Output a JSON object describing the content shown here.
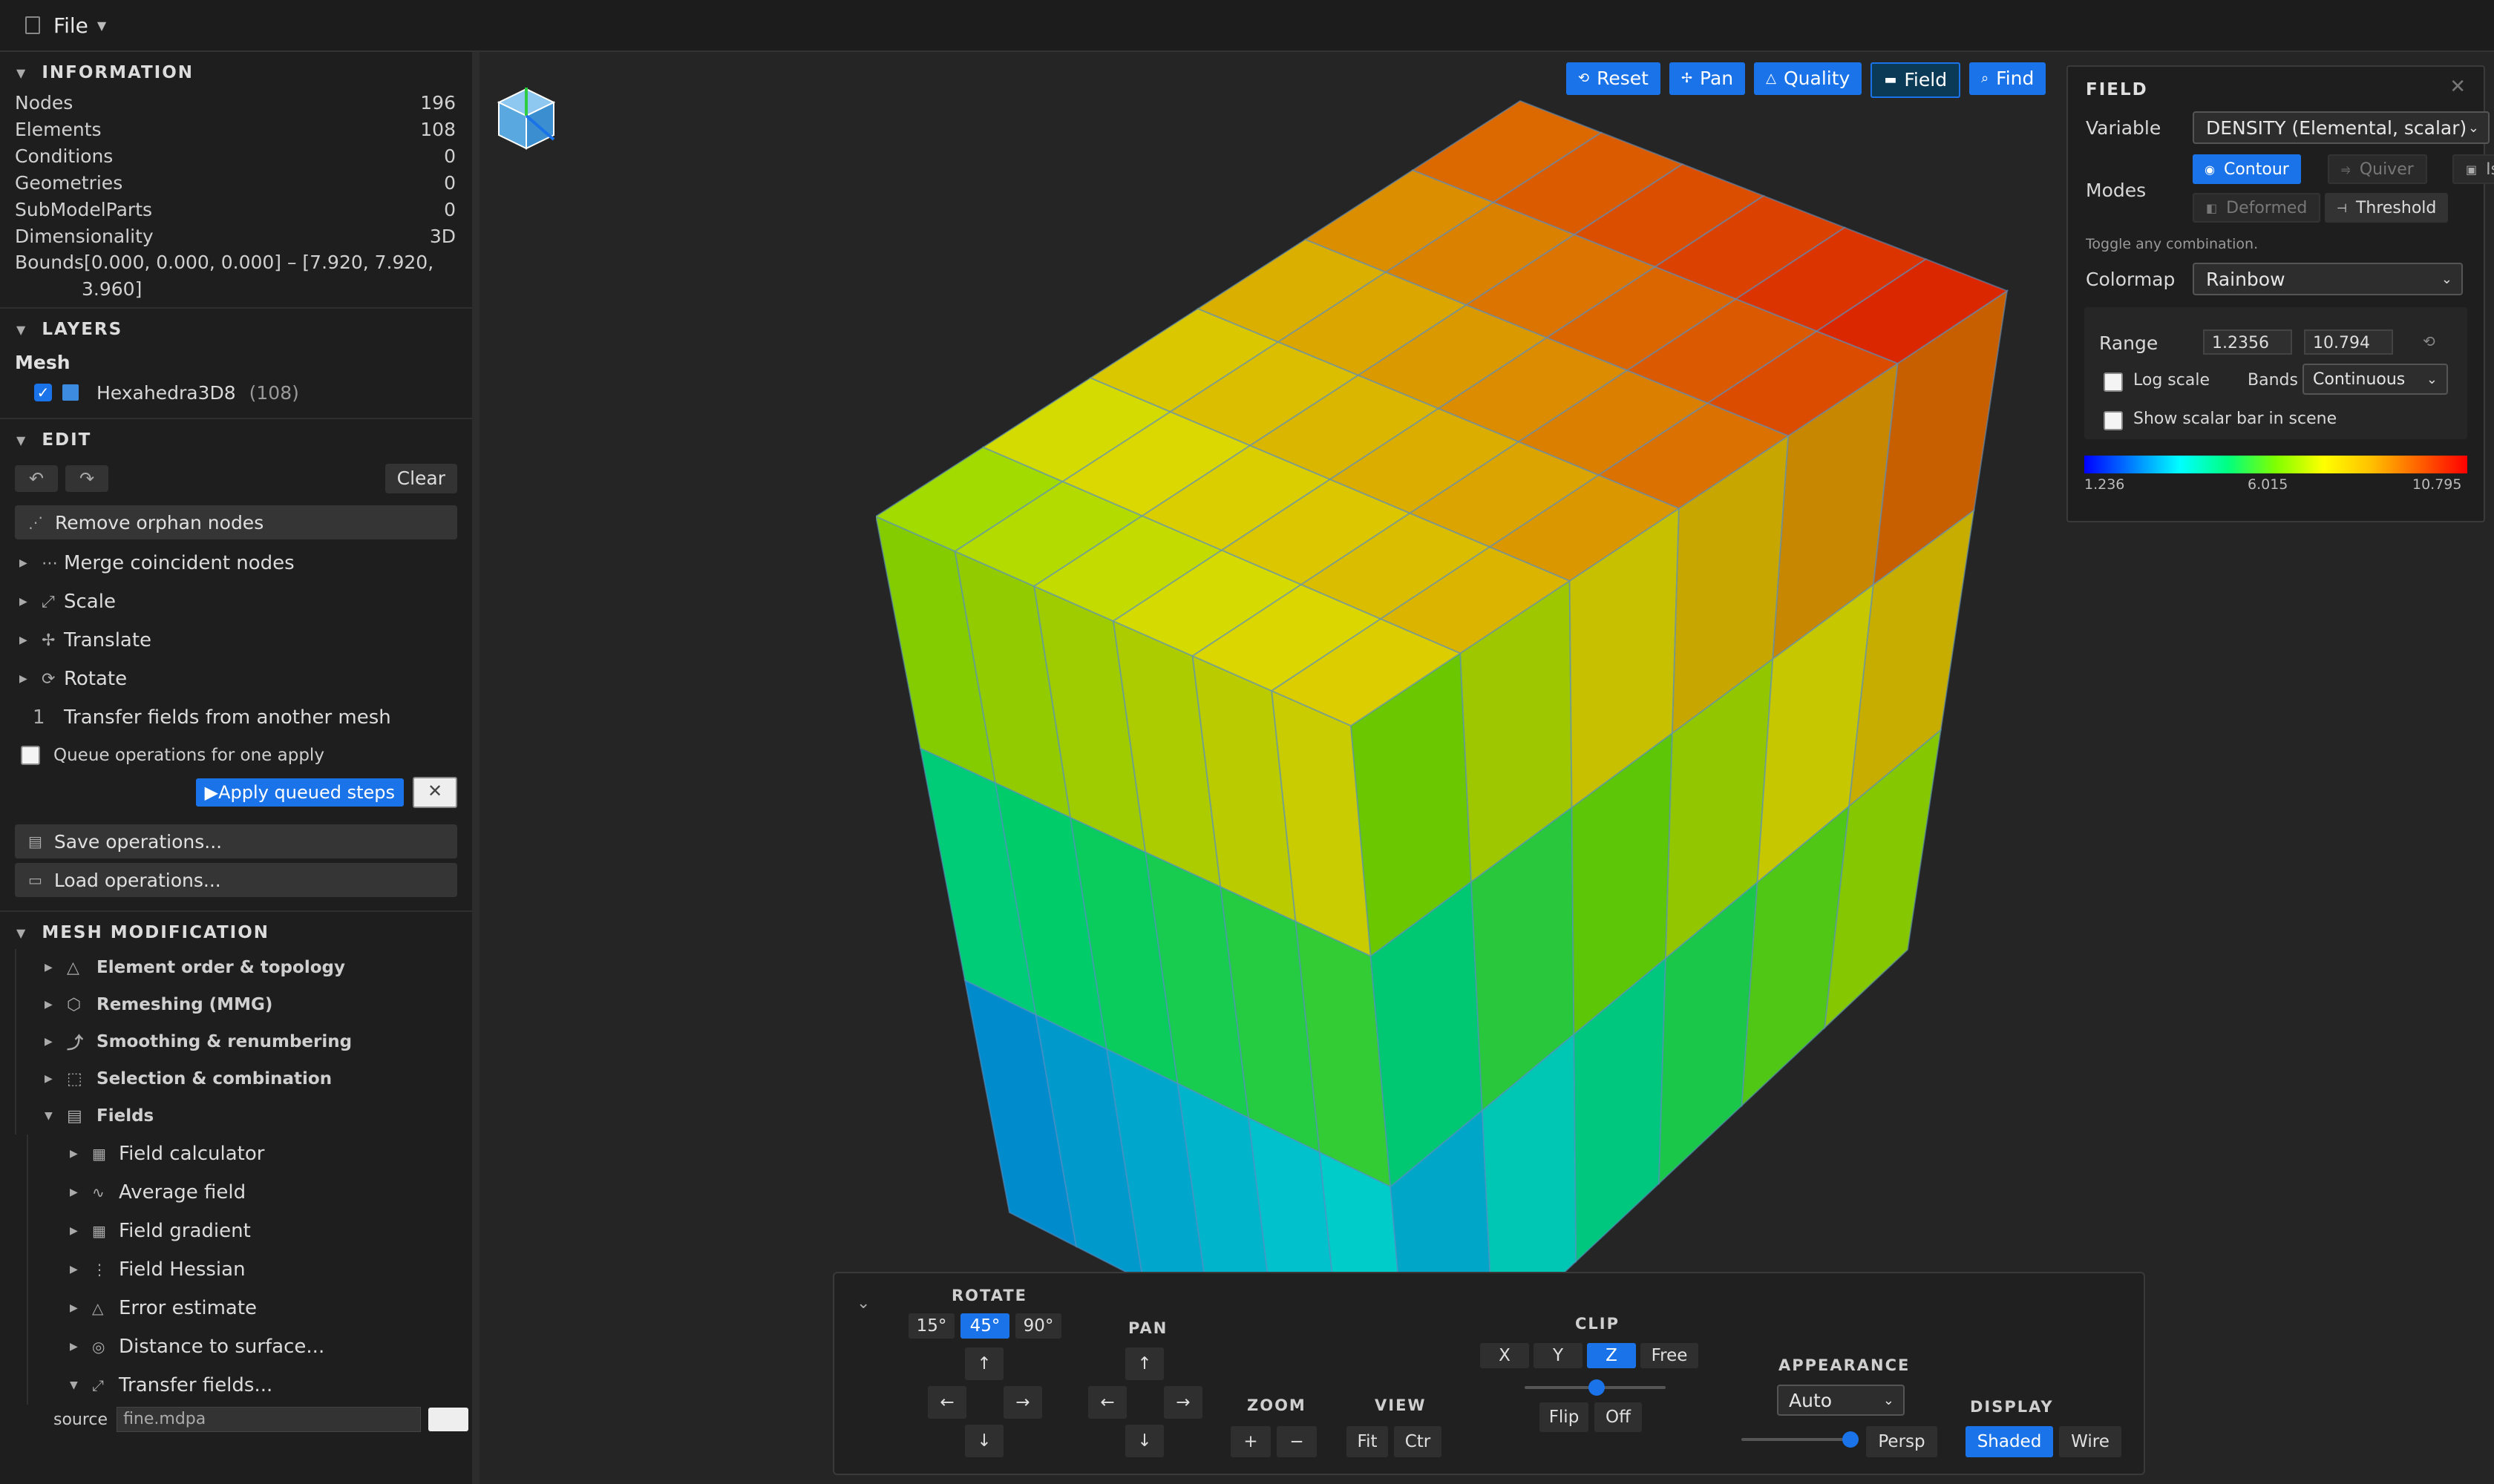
{
  "menubar": {
    "file": "File"
  },
  "sidebar": {
    "information": {
      "title": "INFORMATION",
      "rows": [
        {
          "label": "Nodes",
          "value": "196"
        },
        {
          "label": "Elements",
          "value": "108"
        },
        {
          "label": "Conditions",
          "value": "0"
        },
        {
          "label": "Geometries",
          "value": "0"
        },
        {
          "label": "SubModelParts",
          "value": "0"
        },
        {
          "label": "Dimensionality",
          "value": "3D"
        }
      ],
      "bounds_line1": "Bounds[0.000, 0.000, 0.000] – [7.920, 7.920,",
      "bounds_line2": "3.960]"
    },
    "layers": {
      "title": "LAYERS",
      "mesh_title": "Mesh",
      "layer_name": "Hexahedra3D8",
      "layer_count": "(108)",
      "layer_color": "#3d8be0"
    },
    "edit": {
      "title": "EDIT",
      "undo_icon": "undo-icon",
      "redo_icon": "redo-icon",
      "clear": "Clear",
      "remove_orphan": "Remove orphan nodes",
      "merge": "Merge coincident nodes",
      "scale": "Scale",
      "translate": "Translate",
      "rotate": "Rotate",
      "transfer_num": "1",
      "transfer": "Transfer fields from another mesh",
      "queue": "Queue operations for one apply",
      "apply": "Apply queued steps",
      "save": "Save operations...",
      "load": "Load operations..."
    },
    "mesh_mod": {
      "title": "MESH MODIFICATION",
      "items": [
        "Element order & topology",
        "Remeshing (MMG)",
        "Smoothing & renumbering",
        "Selection & combination",
        "Fields"
      ],
      "fields_items": [
        "Field calculator",
        "Average field",
        "Field gradient",
        "Field Hessian",
        "Error estimate",
        "Distance to surface...",
        "Transfer fields..."
      ],
      "source_label": "source",
      "source_value": "fine.mdpa"
    }
  },
  "toolbar": {
    "reset": "Reset",
    "pan": "Pan",
    "quality": "Quality",
    "field": "Field",
    "find": "Find"
  },
  "field_panel": {
    "title": "FIELD",
    "variable_label": "Variable",
    "variable_value": "DENSITY (Elemental, scalar)",
    "modes_label": "Modes",
    "contour": "Contour",
    "quiver": "Quiver",
    "is": "Is",
    "deformed": "Deformed",
    "threshold": "Threshold",
    "hint": "Toggle any combination.",
    "colormap_label": "Colormap",
    "colormap_value": "Rainbow",
    "range_label": "Range",
    "range_min": "1.2356",
    "range_max": "10.794",
    "log_scale": "Log scale",
    "bands_label": "Bands",
    "bands_value": "Continuous",
    "show_scalar_bar": "Show scalar bar in scene",
    "tick_min": "1.236",
    "tick_mid": "6.015",
    "tick_max": "10.795"
  },
  "dock": {
    "rotate": "ROTATE",
    "rot_15": "15°",
    "rot_45": "45°",
    "rot_90": "90°",
    "pan": "PAN",
    "zoom": "ZOOM",
    "zoom_in": "+",
    "zoom_out": "−",
    "view": "VIEW",
    "fit": "Fit",
    "ctr": "Ctr",
    "clip": "CLIP",
    "clip_x": "X",
    "clip_y": "Y",
    "clip_z": "Z",
    "clip_free": "Free",
    "flip": "Flip",
    "off": "Off",
    "appearance": "APPEARANCE",
    "appearance_value": "Auto",
    "persp": "Persp",
    "display": "DISPLAY",
    "shaded": "Shaded",
    "wire": "Wire",
    "arrow_up": "↑",
    "arrow_down": "↓",
    "arrow_left": "←",
    "arrow_right": "→"
  },
  "colors": {
    "accent": "#1a73e8",
    "background": "#1e1e1e",
    "viewport": "#252525"
  }
}
